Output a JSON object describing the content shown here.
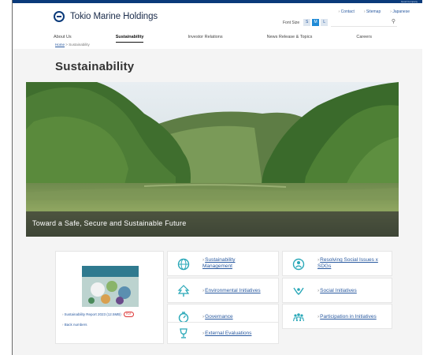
{
  "top_strip": {
    "text": "Good Company"
  },
  "header": {
    "logo_text": "Tokio Marine Holdings",
    "util_links": [
      "Contact",
      "Sitemap",
      "Japanese"
    ],
    "font_size_label": "Font Size",
    "font_sizes": [
      "S",
      "M",
      "L"
    ],
    "font_size_selected": "M"
  },
  "nav": {
    "items": [
      "About Us",
      "Sustainability",
      "Investor Relations",
      "News Release & Topics",
      "Careers"
    ],
    "active": "Sustainability"
  },
  "breadcrumb": {
    "home": "Home",
    "separator": ">",
    "current": "Sustainability"
  },
  "page_title": "Sustainability",
  "hero": {
    "caption": "Toward a Safe, Secure and Sustainable Future"
  },
  "report_panel": {
    "report_link": "Sustainability Report 2023 (12.5MB)",
    "badge": "PDF",
    "back_numbers": "Back numbers"
  },
  "tiles": [
    {
      "label": "Sustainability Management",
      "icon": "globe-icon"
    },
    {
      "label": "Resolving Social Issues x SDGs",
      "icon": "people-circle-icon"
    },
    {
      "label": "Environmental Initiatives",
      "icon": "tree-icon"
    },
    {
      "label": "Social Initiatives",
      "icon": "hands-icon"
    },
    {
      "label": "Governance",
      "icon": "gauge-icon"
    },
    {
      "label": "Participation in Initiatives",
      "icon": "group-icon"
    },
    {
      "label": "External Evaluations",
      "icon": "trophy-icon"
    }
  ],
  "colors": {
    "link": "#2a5aa0",
    "brand": "#0a3a7a",
    "accent": "#1f8ad6",
    "icon_teal": "#2aa8b8"
  }
}
